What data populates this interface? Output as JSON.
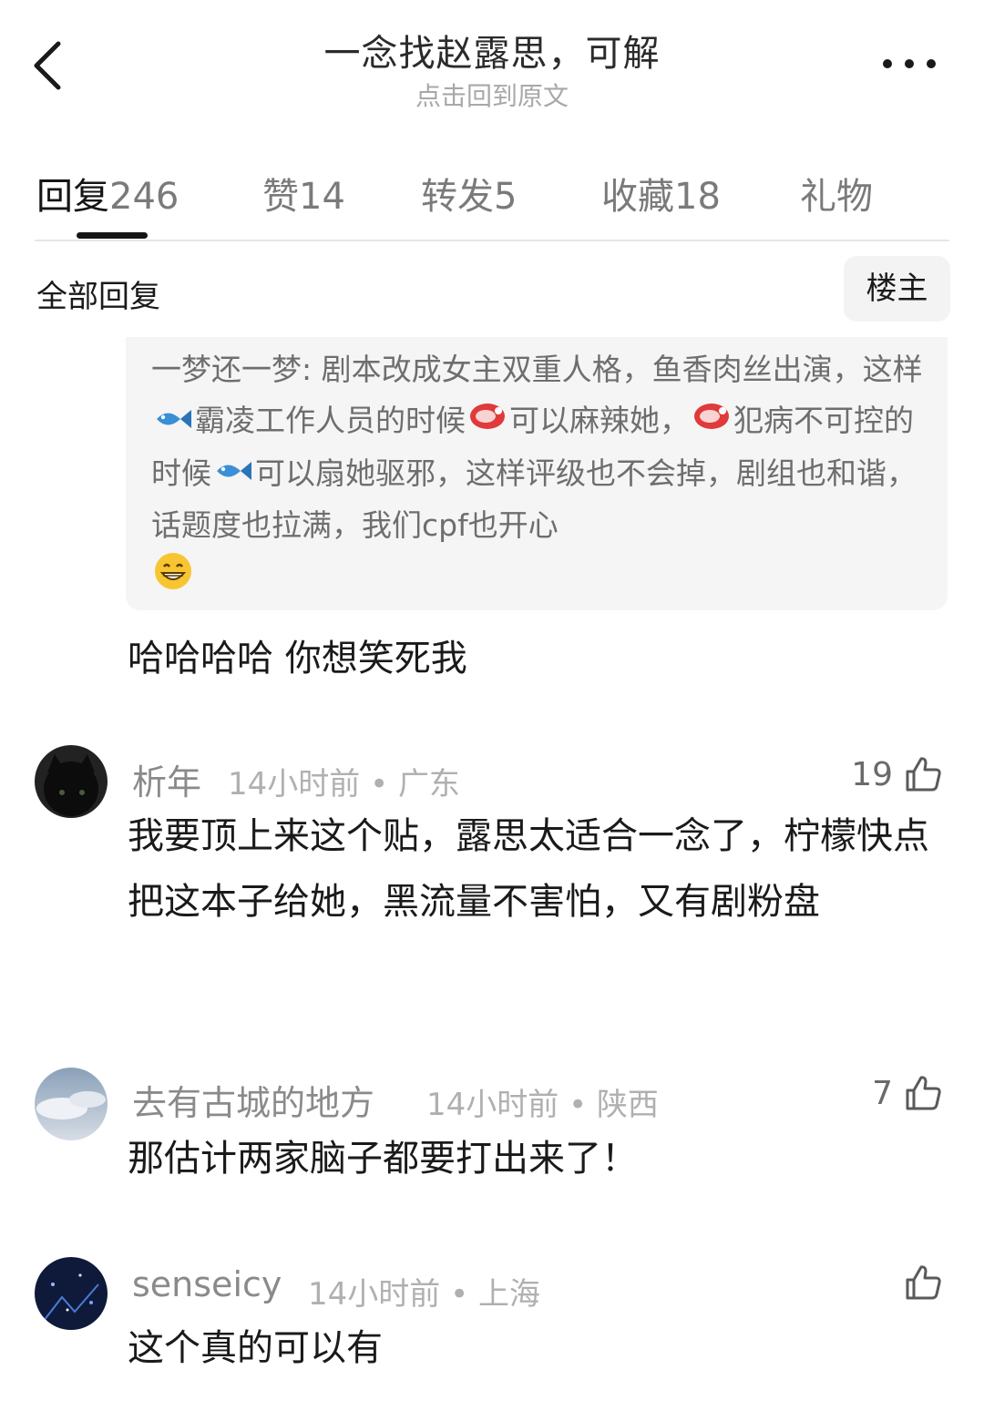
{
  "header": {
    "title": "一念找赵露思，可解",
    "subtitle": "点击回到原文",
    "back_icon": "chevron-left-icon",
    "more_icon": "more-horizontal-icon"
  },
  "tabs": [
    {
      "label": "回复",
      "count": "246",
      "active": true
    },
    {
      "label": "赞",
      "count": "14",
      "active": false
    },
    {
      "label": "转发",
      "count": "5",
      "active": false
    },
    {
      "label": "收藏",
      "count": "18",
      "active": false
    },
    {
      "label": "礼物",
      "count": "",
      "active": false
    }
  ],
  "filter": {
    "label": "全部回复",
    "owner_button": "楼主"
  },
  "quote": {
    "author": "一梦还一梦",
    "segments": [
      "一梦还一梦: 剧本改成女主双重人格，鱼香肉丝出演，这样",
      "霸凌工作人员的时候",
      "可以麻辣她，",
      "犯病不可控的时候",
      "可以扇她驱邪，这样评级也不会掉，剧组也和谐，话题度也拉满，我们cpf也开心"
    ],
    "reply": "哈哈哈哈 你想笑死我"
  },
  "comments": [
    {
      "name": "析年",
      "time": "14小时前",
      "location": "广东",
      "likes": "19",
      "text": "我要顶上来这个贴，露思太适合一念了，柠檬快点把这本子给她，黑流量不害怕，又有剧粉盘"
    },
    {
      "name": "去有古城的地方",
      "time": "14小时前",
      "location": "陕西",
      "likes": "7",
      "text": "那估计两家脑子都要打出来了！"
    },
    {
      "name": "senseicy",
      "time": "14小时前",
      "location": "上海",
      "likes": "",
      "text": "这个真的可以有"
    }
  ],
  "colors": {
    "text_primary": "#1a1a1a",
    "text_muted": "#8a8a8a",
    "quote_bg": "#f5f5f5",
    "divider": "#e6e6e6"
  }
}
